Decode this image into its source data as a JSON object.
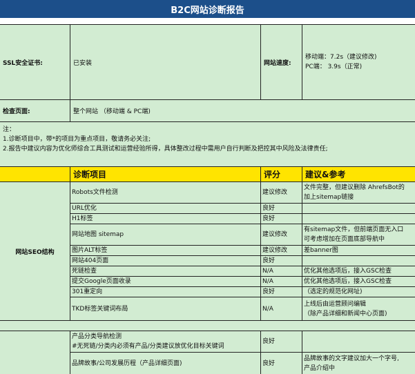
{
  "title": "B2C网站诊断报告",
  "info": {
    "ssl_label": "SSL安全证书:",
    "ssl_value": "已安装",
    "speed_label": "网站速度:",
    "speed_mobile": "移动端：7.2s（建议修改)",
    "speed_pc": "PC端：  3.9s（正常)"
  },
  "scope": {
    "label": "检查页面:",
    "value": "整个网站  （移动端 & PC端)"
  },
  "notes": {
    "heading": "注：",
    "line1": "1.诊断项目中，带*的项目为重点项目，敬请务必关注;",
    "line2": "2.报告中建议内容为优化师综合工具测试和运营经验所得，具体整改过程中需用户自行判断及把控其中风险及法律责任;"
  },
  "table": {
    "headers": [
      "",
      "诊断项目",
      "评分",
      "建议&参考"
    ],
    "section1_label": "网站SEO结构",
    "rows1": [
      {
        "item": "Robots文件检测",
        "score": "建议修改",
        "advice1": "文件完整，但建议删除 AhrefsBot的",
        "advice2": "加上sitemap链接"
      },
      {
        "item": "URL优化",
        "score": "良好",
        "advice1": "",
        "advice2": ""
      },
      {
        "item": "H1标签",
        "score": "良好",
        "advice1": "",
        "advice2": ""
      },
      {
        "item": "网站地图 sitemap",
        "score": "建议修改",
        "advice1": "有sitemap文件，但前端页面无入口",
        "advice2": "可考虑增加在页面底部导航中"
      },
      {
        "item": "图片ALT标签",
        "score": "建议修改",
        "advice1": "差banner图",
        "advice2": ""
      },
      {
        "item": "网站404页面",
        "score": "良好",
        "advice1": "",
        "advice2": ""
      },
      {
        "item": "死链检查",
        "score": "N/A",
        "advice1": "优化其他选项后，接入GSC检查",
        "advice2": ""
      },
      {
        "item": "提交Google页面收录",
        "score": "N/A",
        "advice1": "优化其他选项后，接入GSC检查",
        "advice2": ""
      },
      {
        "item": "301重定向",
        "score": "良好",
        "advice1": "（选定的规范化网址)",
        "advice2": ""
      },
      {
        "item": "TKD标签关键词布局",
        "score": "N/A",
        "advice1": "上线后由运营顾问编辑",
        "advice2": "（除产品详细和新闻中心页面)"
      }
    ],
    "rows2": [
      {
        "item1": "产品分类导航检测",
        "item2": "#无死链/分类内必须有产品/分类建议放优化目标关键词",
        "score": "良好",
        "advice1": "",
        "advice2": ""
      },
      {
        "item1": "品牌故事/公司发展历程（产品详细页面)",
        "item2": "",
        "score": "良好",
        "advice1": "品牌故事的文字建议加大一个字号,",
        "advice2": "产品介绍中"
      }
    ]
  }
}
